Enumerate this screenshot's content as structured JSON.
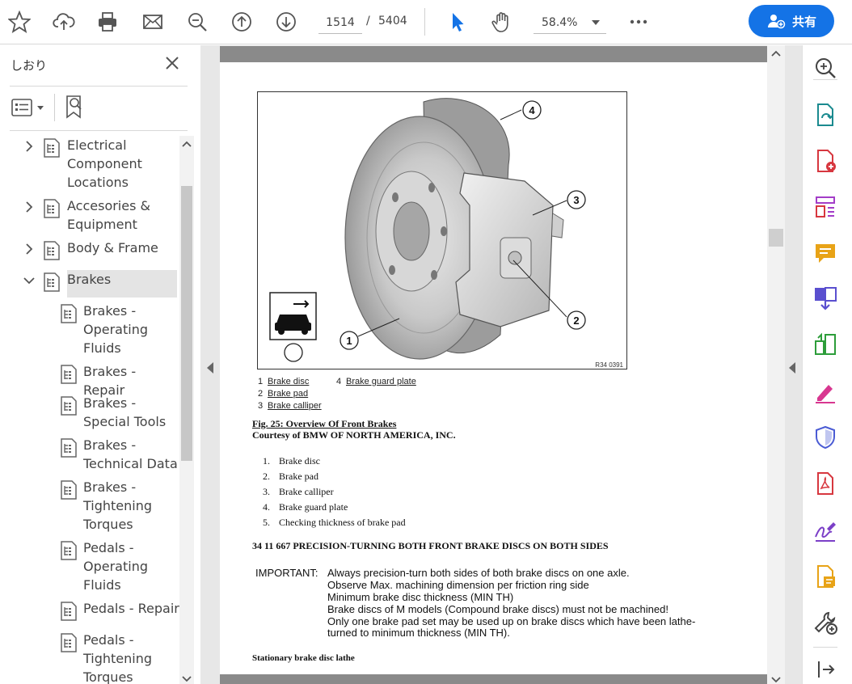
{
  "toolbar": {
    "current_page": "1514",
    "page_separator": "/",
    "total_pages": "5404",
    "zoom": "58.4%",
    "share_label": "共有",
    "accent_color": "#1473e6"
  },
  "bookmarks_panel": {
    "title": "しおり",
    "items": [
      {
        "label": "Electrical\nComponent\nLocations",
        "expanded": false
      },
      {
        "label": "Accesories &\nEquipment",
        "expanded": false
      },
      {
        "label": "Body & Frame",
        "expanded": false
      },
      {
        "label": "Brakes",
        "expanded": true,
        "selected": true
      },
      {
        "label": "Brakes -\nOperating\nFluids"
      },
      {
        "label": "Brakes - Repair"
      },
      {
        "label": "Brakes -\nSpecial Tools"
      },
      {
        "label": "Brakes -\nTechnical Data"
      },
      {
        "label": "Brakes -\nTightening\nTorques"
      },
      {
        "label": "Pedals -\nOperating\nFluids"
      },
      {
        "label": "Pedals - Repair"
      },
      {
        "label": "Pedals -\nTightening\nTorques"
      }
    ]
  },
  "document": {
    "figure": {
      "callouts": [
        "1",
        "2",
        "3",
        "4"
      ],
      "ref_code": "R34 0391"
    },
    "legend": [
      {
        "num": "1",
        "label": "Brake disc"
      },
      {
        "num": "2",
        "label": "Brake pad"
      },
      {
        "num": "3",
        "label": "Brake calliper"
      },
      {
        "num": "4",
        "label": "Brake guard plate"
      }
    ],
    "caption_title": "Fig. 25: Overview Of Front Brakes",
    "caption_credit": "Courtesy of BMW OF NORTH AMERICA, INC.",
    "numbered_list": [
      {
        "num": "1.",
        "text": "Brake disc"
      },
      {
        "num": "2.",
        "text": "Brake pad"
      },
      {
        "num": "3.",
        "text": "Brake calliper"
      },
      {
        "num": "4.",
        "text": "Brake guard plate"
      },
      {
        "num": "5.",
        "text": "Checking thickness of brake pad"
      }
    ],
    "section_heading": "34 11 667 PRECISION-TURNING BOTH FRONT BRAKE DISCS ON BOTH SIDES",
    "important_label": "IMPORTANT:",
    "important_lines": [
      "Always precision-turn both sides of both brake discs on one axle.",
      "Observe Max. machining dimension per friction ring side",
      "Minimum brake disc thickness (MIN TH)",
      "Brake discs of M models (Compound brake discs) must not be machined!",
      "Only one brake pad set may be used up on brake discs which have been lathe-"
    ],
    "important_continuation": "turned to minimum thickness (MIN TH).",
    "subheading": "Stationary brake disc lathe"
  }
}
